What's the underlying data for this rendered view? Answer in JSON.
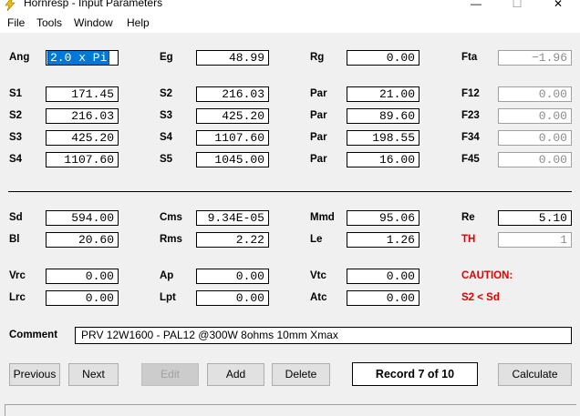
{
  "window": {
    "title": "Hornresp - Input Parameters",
    "minimize": "—",
    "maximize": "☐",
    "close": "✕"
  },
  "menu": [
    "File",
    "Tools",
    "Window",
    "Help"
  ],
  "rows": {
    "r0": {
      "c1": {
        "label": "Ang",
        "value": "2.0 x Pi",
        "selected": true
      },
      "c2": {
        "label": "Eg",
        "value": "48.99"
      },
      "c3": {
        "label": "Rg",
        "value": "0.00"
      },
      "c4": {
        "label": "Fta",
        "value": "−1.96",
        "disabled": true
      }
    },
    "r1": {
      "c1": {
        "label": "S1",
        "value": "171.45"
      },
      "c2": {
        "label": "S2",
        "value": "216.03"
      },
      "c3": {
        "label": "Par",
        "value": "21.00"
      },
      "c4": {
        "label": "F12",
        "value": "0.00",
        "disabled": true
      }
    },
    "r2": {
      "c1": {
        "label": "S2",
        "value": "216.03"
      },
      "c2": {
        "label": "S3",
        "value": "425.20"
      },
      "c3": {
        "label": "Par",
        "value": "89.60"
      },
      "c4": {
        "label": "F23",
        "value": "0.00",
        "disabled": true
      }
    },
    "r3": {
      "c1": {
        "label": "S3",
        "value": "425.20"
      },
      "c2": {
        "label": "S4",
        "value": "1107.60"
      },
      "c3": {
        "label": "Par",
        "value": "198.55"
      },
      "c4": {
        "label": "F34",
        "value": "0.00",
        "disabled": true
      }
    },
    "r4": {
      "c1": {
        "label": "S4",
        "value": "1107.60"
      },
      "c2": {
        "label": "S5",
        "value": "1045.00"
      },
      "c3": {
        "label": "Par",
        "value": "16.00"
      },
      "c4": {
        "label": "F45",
        "value": "0.00",
        "disabled": true
      }
    },
    "r5": {
      "c1": {
        "label": "Sd",
        "value": "594.00"
      },
      "c2": {
        "label": "Cms",
        "value": "9.34E-05"
      },
      "c3": {
        "label": "Mmd",
        "value": "95.06"
      },
      "c4": {
        "label": "Re",
        "value": "5.10"
      }
    },
    "r6": {
      "c1": {
        "label": "Bl",
        "value": "20.60"
      },
      "c2": {
        "label": "Rms",
        "value": "2.22"
      },
      "c3": {
        "label": "Le",
        "value": "1.26"
      },
      "c4": {
        "label": "TH",
        "value": "1",
        "disabled": true
      }
    },
    "r7": {
      "c1": {
        "label": "Vrc",
        "value": "0.00"
      },
      "c2": {
        "label": "Ap",
        "value": "0.00"
      },
      "c3": {
        "label": "Vtc",
        "value": "0.00"
      },
      "c4": {
        "label": "CAUTION:"
      }
    },
    "r8": {
      "c1": {
        "label": "Lrc",
        "value": "0.00"
      },
      "c2": {
        "label": "Lpt",
        "value": "0.00"
      },
      "c3": {
        "label": "Atc",
        "value": "0.00"
      },
      "c4": {
        "label": "S2 < Sd"
      }
    }
  },
  "comment": {
    "label": "Comment",
    "value": "PRV 12W1600 - PAL12  @300W 8ohms 10mm Xmax"
  },
  "buttons": {
    "previous": "Previous",
    "next": "Next",
    "edit": "Edit",
    "add": "Add",
    "delete": "Delete",
    "calculate": "Calculate"
  },
  "record": "Record 7 of 10",
  "colors": {
    "warning": "#e00000",
    "selection": "#0078d7",
    "window_bg": "#f0f0f0",
    "titlebar_icon": "#f2c200"
  }
}
